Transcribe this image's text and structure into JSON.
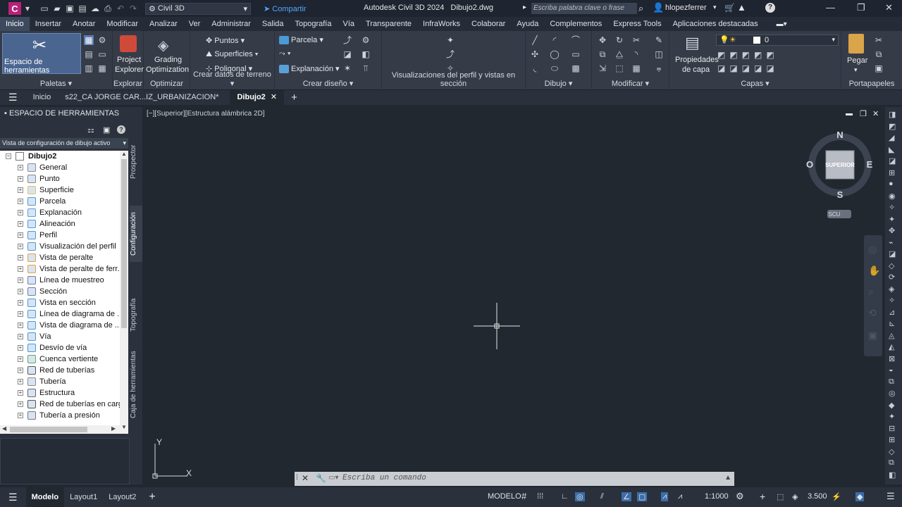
{
  "titlebar": {
    "logo": "C",
    "workspace": "Civil 3D",
    "share": "Compartir",
    "app_title": "Autodesk Civil 3D 2024",
    "doc_name": "Dibujo2.dwg",
    "search_placeholder": "Escriba palabra clave o frase",
    "user": "hlopezferrer"
  },
  "menu_tabs": [
    "Inicio",
    "Insertar",
    "Anotar",
    "Modificar",
    "Analizar",
    "Ver",
    "Administrar",
    "Salida",
    "Topografía",
    "Vía",
    "Transparente",
    "InfraWorks",
    "Colaborar",
    "Ayuda",
    "Complementos",
    "Express Tools",
    "Aplicaciones destacadas"
  ],
  "ribbon": {
    "toolspace": "Espacio de herramientas",
    "project_explorer_1": "Project",
    "project_explorer_2": "Explorer",
    "grading_1": "Grading",
    "grading_2": "Optimization",
    "puntos": "Puntos",
    "superficies": "Superficies",
    "poligonal": "Poligonal",
    "parcela": "Parcela",
    "explanacion": "Explanación",
    "propiedades_1": "Propiedades",
    "propiedades_2": "de capa",
    "pegar": "Pegar",
    "layer_value": "0",
    "panels": {
      "paletas": "Paletas",
      "explorar": "Explorar",
      "optimizar": "Optimizar",
      "crear_datos": "Crear datos de terreno",
      "crear_diseno": "Crear diseño",
      "visualizaciones": "Visualizaciones del perfil y vistas en sección",
      "dibujo": "Dibujo",
      "modificar": "Modificar",
      "capas": "Capas",
      "portapapeles": "Portapapeles"
    }
  },
  "doc_tabs": {
    "inicio": "Inicio",
    "file1": "s22_CA JORGE CAR...IZ_URBANIZACION*",
    "file2": "Dibujo2"
  },
  "palette": {
    "title": "ESPACIO DE HERRAMIENTAS",
    "select_value": "Vista de configuración de dibujo activo",
    "root": "Dibujo2",
    "items": [
      "General",
      "Punto",
      "Superficie",
      "Parcela",
      "Explanación",
      "Alineación",
      "Perfil",
      "Visualización del perfil",
      "Vista de peralte",
      "Vista de peralte de ferr...",
      "Línea de muestreo",
      "Sección",
      "Vista en sección",
      "Línea de diagrama de ...",
      "Vista de diagrama de ...",
      "Vía",
      "Desvío de vía",
      "Cuenca vertiente",
      "Red de tuberías",
      "Tubería",
      "Estructura",
      "Red de tuberías en carga",
      "Tubería a presión"
    ],
    "vtabs": [
      "Prospector",
      "Configuración",
      "Topografía",
      "Caja de herramientas"
    ]
  },
  "viewport": {
    "label": "[−][Superior][Estructura alámbrica 2D]",
    "compass_n": "N",
    "compass_s": "S",
    "compass_e": "E",
    "compass_w": "O",
    "viewcube_face": "SUPERIOR",
    "ucs_badge": "SCU",
    "axis_y": "Y",
    "axis_x": "X"
  },
  "command": {
    "placeholder": "Escriba un comando"
  },
  "status": {
    "tabs": [
      "Modelo",
      "Layout1",
      "Layout2"
    ],
    "mode": "MODELO",
    "scale": "1:1000",
    "value": "3.500"
  },
  "colors": {
    "background": "#212830",
    "ribbon": "#353c48",
    "accent": "#52a8ff",
    "logo": "#b8217a"
  }
}
